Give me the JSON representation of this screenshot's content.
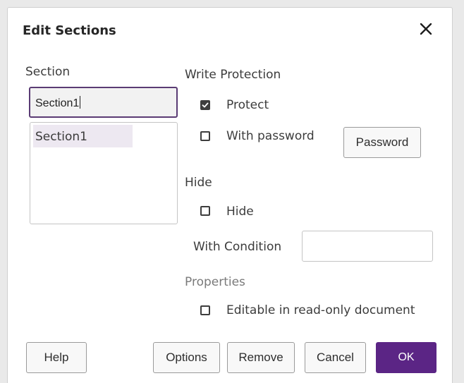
{
  "dialog": {
    "title": "Edit Sections",
    "close_icon": "close-icon"
  },
  "section": {
    "label": "Section",
    "name_value": "Section1",
    "list_items": [
      "Section1"
    ],
    "selected_item": "Section1"
  },
  "write_protection": {
    "heading": "Write Protection",
    "protect": {
      "label": "Protect",
      "checked": true
    },
    "with_password": {
      "label": "With password",
      "checked": false
    },
    "password_button": "Password"
  },
  "hide": {
    "heading": "Hide",
    "hide": {
      "label": "Hide",
      "checked": false
    },
    "condition_label": "With Condition",
    "condition_value": ""
  },
  "properties": {
    "heading": "Properties",
    "editable_readonly": {
      "label": "Editable in read-only document",
      "checked": false
    }
  },
  "buttons": {
    "help": "Help",
    "options": "Options",
    "remove": "Remove",
    "cancel": "Cancel",
    "ok": "OK"
  },
  "colors": {
    "accent": "#5b2585",
    "selection": "#ede8f1",
    "focus_border": "#5a3b74"
  }
}
